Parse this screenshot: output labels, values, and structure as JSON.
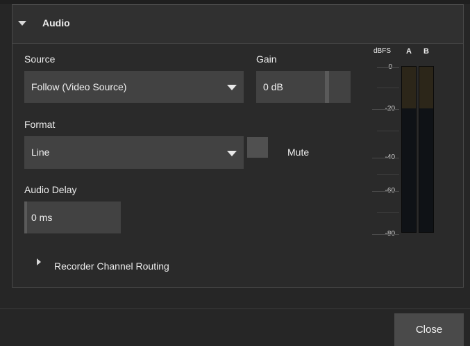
{
  "panel": {
    "title": "Audio",
    "source_label": "Source",
    "source_value": "Follow (Video Source)",
    "gain_label": "Gain",
    "gain_value": "0 dB",
    "format_label": "Format",
    "format_value": "Line",
    "mute_label": "Mute",
    "mute_checked": false,
    "audio_delay_label": "Audio Delay",
    "audio_delay_value": "0 ms",
    "recorder_routing_label": "Recorder Channel Routing"
  },
  "meter": {
    "unit_label": "dBFS",
    "channel_a": "A",
    "channel_b": "B",
    "ticks": [
      "0",
      "-20",
      "-40",
      "-60",
      "-80"
    ]
  },
  "footer": {
    "close_label": "Close"
  }
}
